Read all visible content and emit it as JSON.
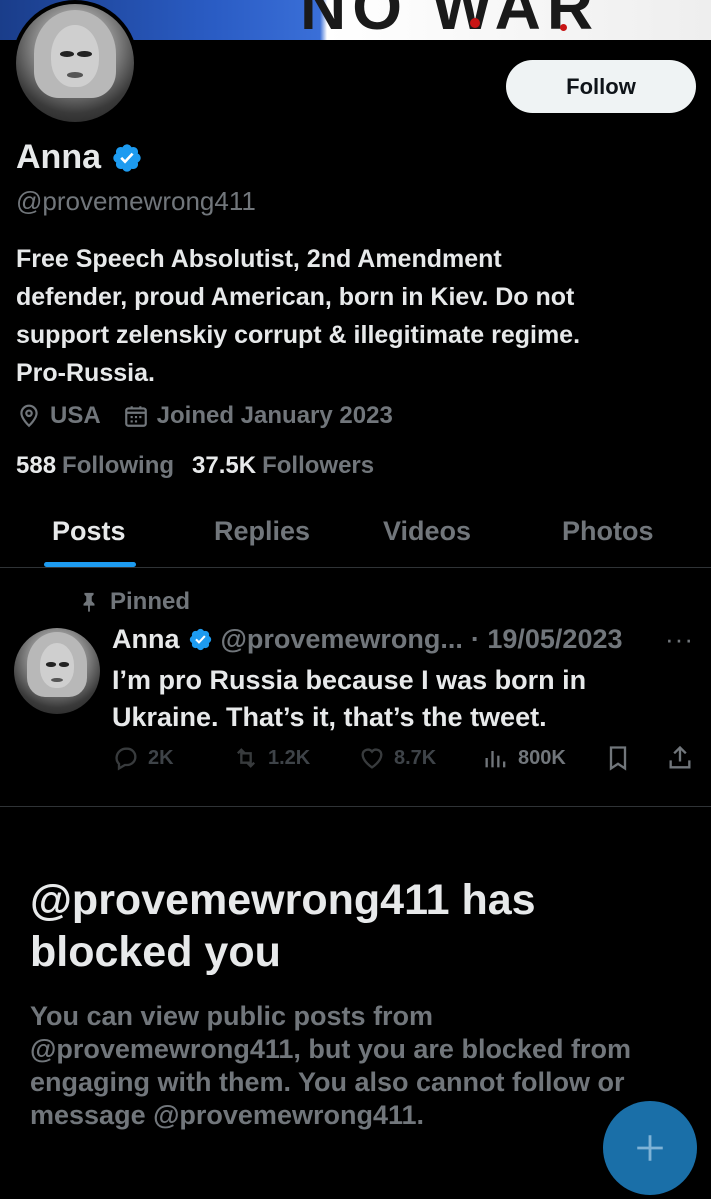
{
  "banner": {
    "graffiti_text": "NO WAR"
  },
  "profile": {
    "name": "Anna",
    "handle": "@provemewrong411",
    "bio_lines": [
      "Free Speech Absolutist, 2nd Amendment",
      "defender, proud American, born in Kiev. Do not",
      "support zelenskiy corrupt & illegitimate regime.",
      "Pro-Russia."
    ],
    "location": "USA",
    "joined": "Joined January 2023",
    "following_count": "588",
    "following_label": "Following",
    "followers_count": "37.5K",
    "followers_label": "Followers",
    "follow_button": "Follow"
  },
  "tabs": [
    {
      "label": "Posts",
      "active": true
    },
    {
      "label": "Replies",
      "active": false
    },
    {
      "label": "Videos",
      "active": false
    },
    {
      "label": "Photos",
      "active": false
    }
  ],
  "pinned_post": {
    "pinned_label": "Pinned",
    "author": "Anna",
    "handle": "@provemewrong...",
    "date": "· 19/05/2023",
    "more": "···",
    "text_lines": [
      "I’m pro Russia because I was born in",
      "Ukraine. That’s it, that’s the tweet."
    ],
    "replies": "2K",
    "reposts": "1.2K",
    "likes": "8.7K",
    "views": "800K"
  },
  "blocked": {
    "title_lines": [
      "@provemewrong411 has",
      "blocked you"
    ],
    "description_lines": [
      "You can view public posts from",
      "@provemewrong411, but you are blocked from",
      "engaging with them. You also cannot follow or",
      "message @provemewrong411."
    ]
  },
  "colors": {
    "accent": "#1d9bf0",
    "background": "#000000",
    "secondary_text": "#71767b",
    "fab": "#1a6fa8"
  },
  "icons": {
    "verified": "verified-badge-icon",
    "location": "location-pin-icon",
    "calendar": "calendar-icon",
    "pin": "pin-icon",
    "reply": "reply-icon",
    "repost": "repost-icon",
    "like": "heart-icon",
    "views": "views-bar-chart-icon",
    "bookmark": "bookmark-icon",
    "share": "share-icon",
    "compose": "plus-icon"
  }
}
